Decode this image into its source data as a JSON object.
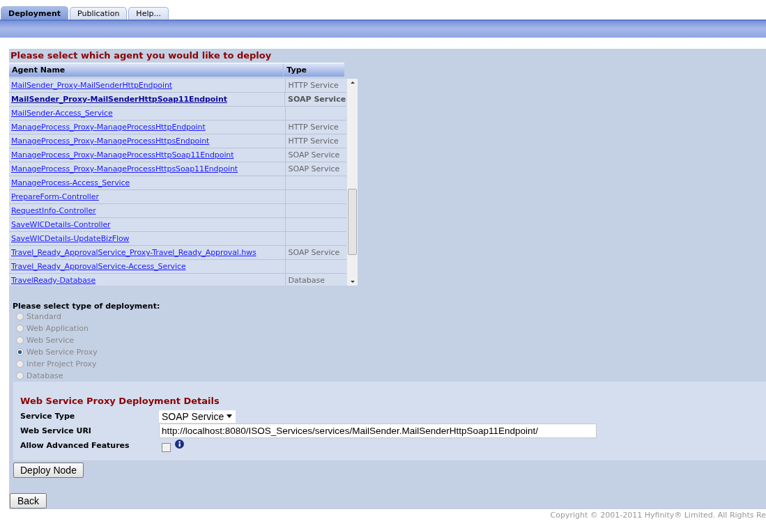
{
  "tabs": [
    {
      "label": "Deployment",
      "selected": true
    },
    {
      "label": "Publication",
      "selected": false
    },
    {
      "label": "Help...",
      "selected": false
    }
  ],
  "agent_section": {
    "title": "Please select which agent you would like to deploy",
    "columns": [
      "Agent Name",
      "Type"
    ],
    "rows": [
      {
        "name": "MailSender_Proxy-MailSenderHttpEndpoint",
        "type": "HTTP Service",
        "selected": false
      },
      {
        "name": "MailSender_Proxy-MailSenderHttpSoap11Endpoint",
        "type": "SOAP Service",
        "selected": true
      },
      {
        "name": "MailSender-Access_Service",
        "type": "",
        "selected": false
      },
      {
        "name": "ManageProcess_Proxy-ManageProcessHttpEndpoint",
        "type": "HTTP Service",
        "selected": false
      },
      {
        "name": "ManageProcess_Proxy-ManageProcessHttpsEndpoint",
        "type": "HTTP Service",
        "selected": false
      },
      {
        "name": "ManageProcess_Proxy-ManageProcessHttpSoap11Endpoint",
        "type": "SOAP Service",
        "selected": false
      },
      {
        "name": "ManageProcess_Proxy-ManageProcessHttpsSoap11Endpoint",
        "type": "SOAP Service",
        "selected": false
      },
      {
        "name": "ManageProcess-Access_Service",
        "type": "",
        "selected": false
      },
      {
        "name": "PrepareForm-Controller",
        "type": "",
        "selected": false
      },
      {
        "name": "RequestInfo-Controller",
        "type": "",
        "selected": false
      },
      {
        "name": "SaveWICDetails-Controller",
        "type": "",
        "selected": false
      },
      {
        "name": "SaveWICDetails-UpdateBizFlow",
        "type": "",
        "selected": false
      },
      {
        "name": "Travel_Ready_ApprovalService_Proxy-Travel_Ready_Approval.hws",
        "type": "SOAP Service",
        "selected": false
      },
      {
        "name": "Travel_Ready_ApprovalService-Access_Service",
        "type": "",
        "selected": false
      },
      {
        "name": "TravelReady-Database",
        "type": "Database",
        "selected": false
      }
    ]
  },
  "deployment_type": {
    "title": "Please select type of deployment:",
    "options": [
      {
        "label": "Standard",
        "selected": false,
        "disabled": true
      },
      {
        "label": "Web Application",
        "selected": false,
        "disabled": true
      },
      {
        "label": "Web Service",
        "selected": false,
        "disabled": true
      },
      {
        "label": "Web Service Proxy",
        "selected": true,
        "disabled": true
      },
      {
        "label": "Inter Project Proxy",
        "selected": false,
        "disabled": true
      },
      {
        "label": "Database",
        "selected": false,
        "disabled": true
      }
    ]
  },
  "details": {
    "title": "Web Service Proxy Deployment Details",
    "service_type": {
      "label": "Service Type",
      "value": "SOAP Service"
    },
    "uri": {
      "label": "Web Service URI",
      "value": "http://localhost:8080/ISOS_Services/services/MailSender.MailSenderHttpSoap11Endpoint/"
    },
    "advanced": {
      "label": "Allow Advanced Features",
      "checked": false
    }
  },
  "deploy_button": "Deploy Node",
  "back_button": "Back",
  "footer": "Copyright © 2001-2011 Hyfinity® Limited. All Rights Re"
}
